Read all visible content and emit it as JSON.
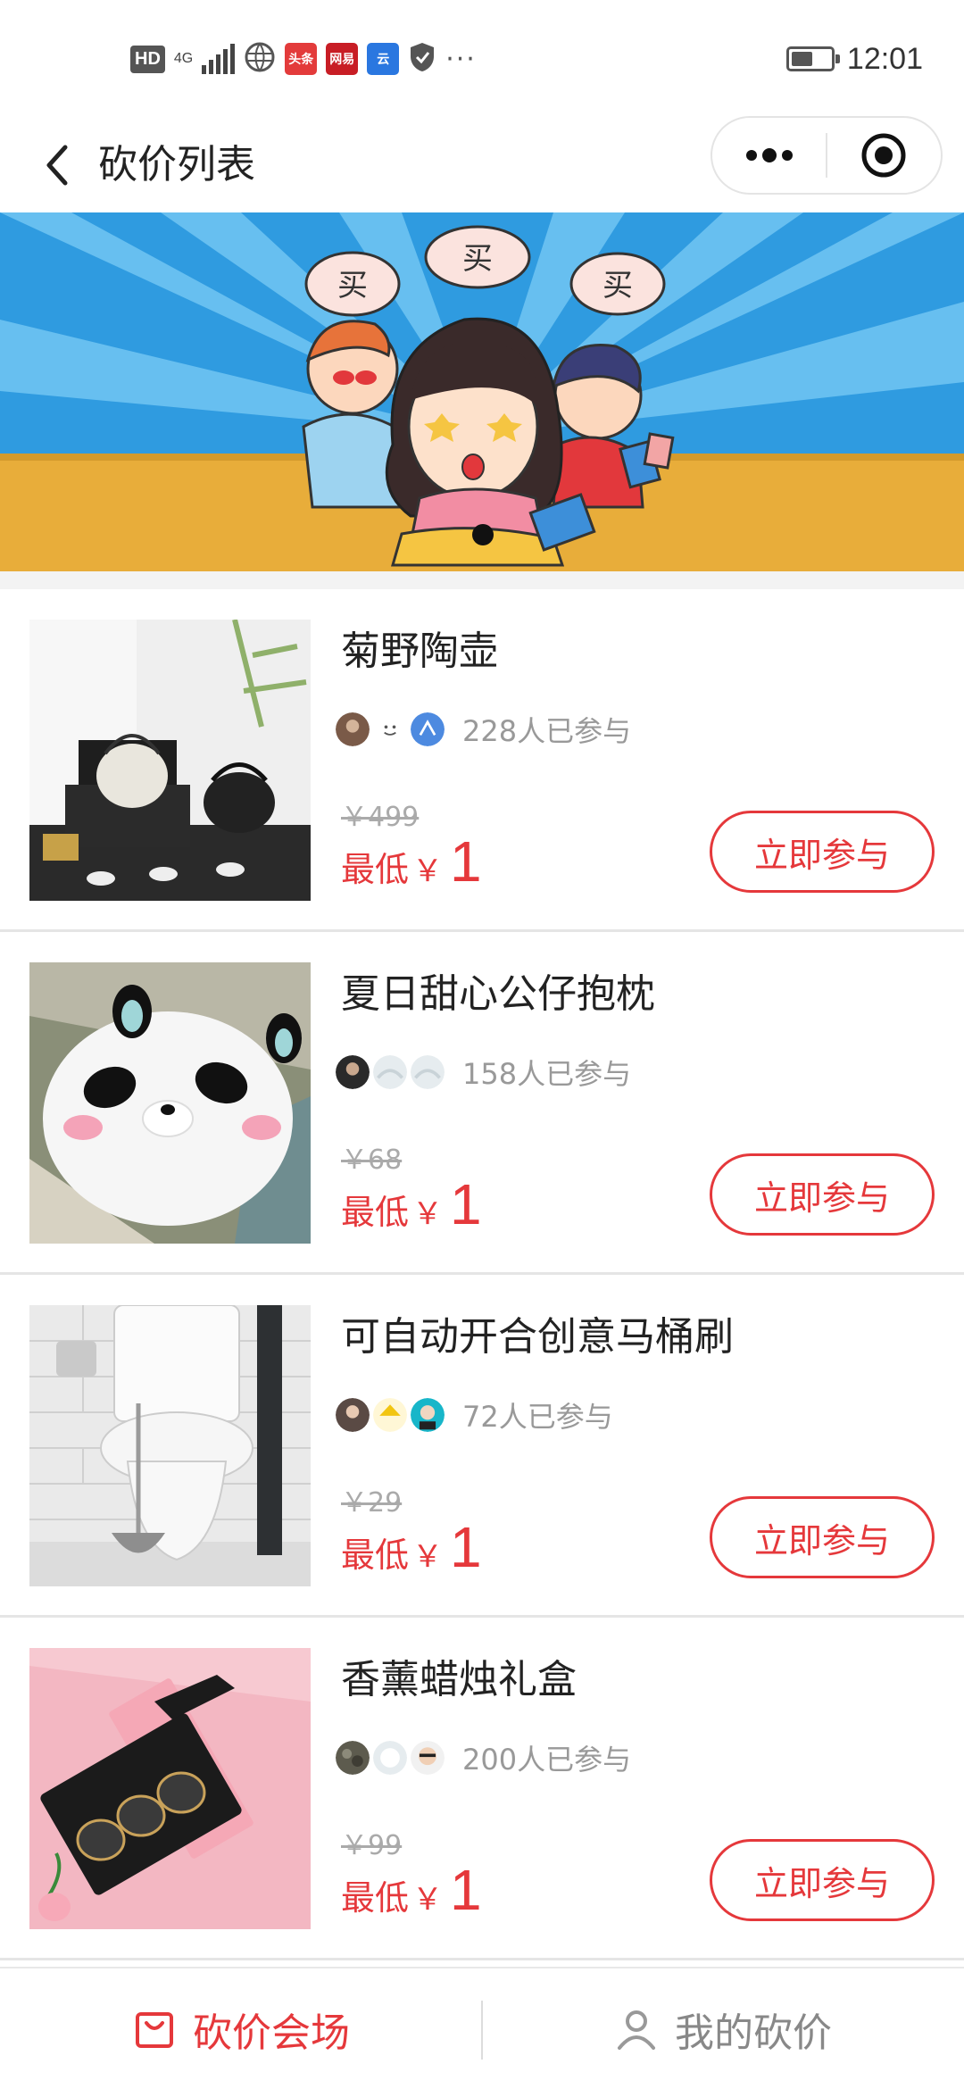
{
  "status_bar": {
    "hd": "HD",
    "network": "4G",
    "apps": [
      {
        "label": "头条",
        "color": "#e33b3b"
      },
      {
        "label": "网易",
        "color": "#c81d25"
      },
      {
        "label": "云",
        "color": "#2a77e0"
      }
    ],
    "more": "···",
    "time": "12:01"
  },
  "nav": {
    "title": "砍价列表",
    "back_icon": "chevron-left-icon",
    "menu_icon": "more-dots-icon",
    "close_icon": "target-icon"
  },
  "banner": {
    "slides": 1,
    "active_slide": 1,
    "thought_text": "买"
  },
  "products": [
    {
      "name": "菊野陶壶",
      "participants": "228人已参与",
      "original_price": "￥499",
      "min_label": "最低",
      "currency": "￥",
      "min_price": "1",
      "button": "立即参与"
    },
    {
      "name": "夏日甜心公仔抱枕",
      "participants": "158人已参与",
      "original_price": "￥68",
      "min_label": "最低",
      "currency": "￥",
      "min_price": "1",
      "button": "立即参与"
    },
    {
      "name": "可自动开合创意马桶刷",
      "participants": "72人已参与",
      "original_price": "￥29",
      "min_label": "最低",
      "currency": "￥",
      "min_price": "1",
      "button": "立即参与"
    },
    {
      "name": "香薰蜡烛礼盒",
      "participants": "200人已参与",
      "original_price": "￥99",
      "min_label": "最低",
      "currency": "￥",
      "min_price": "1",
      "button": "立即参与"
    }
  ],
  "tab_bar": {
    "tabs": [
      {
        "label": "砍价会场",
        "icon": "shopping-bag-icon",
        "active": true
      },
      {
        "label": "我的砍价",
        "icon": "user-icon",
        "active": false
      }
    ]
  },
  "colors": {
    "accent": "#e5383b",
    "banner_sky": "#2f9be0",
    "banner_floor": "#e8ad3a"
  }
}
